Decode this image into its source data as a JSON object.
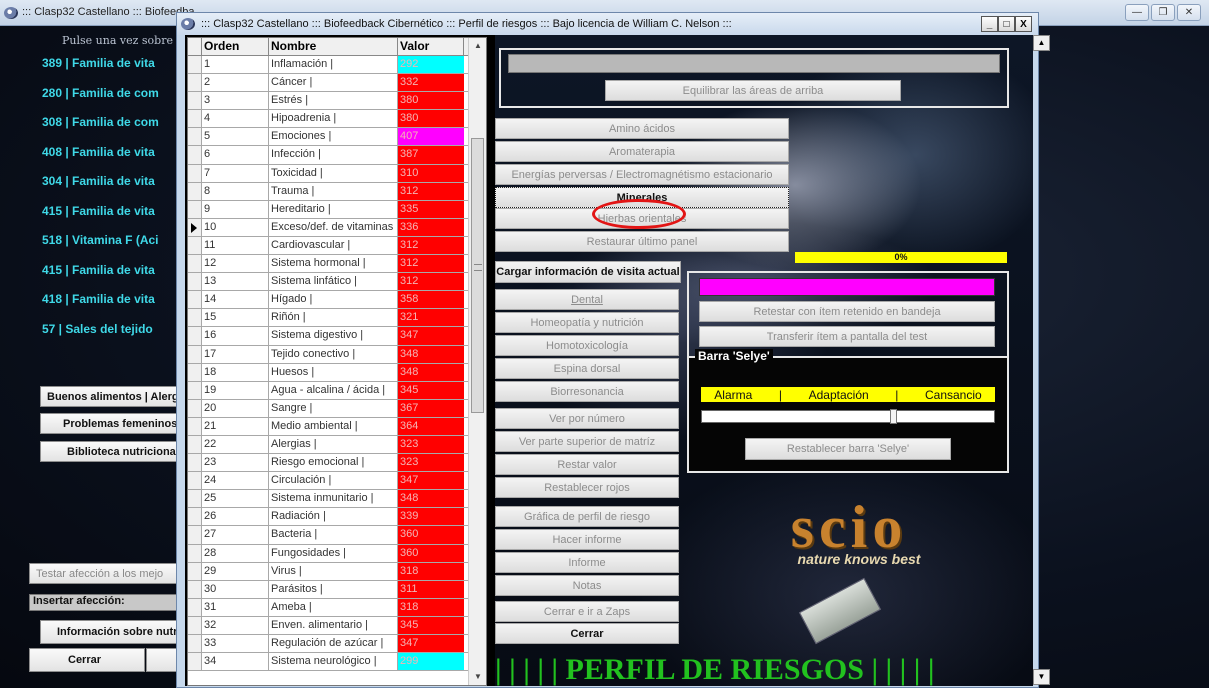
{
  "background_window": {
    "title": "::: Clasp32 Castellano ::: Biofeedba",
    "prompt": "Pulse una vez sobre una",
    "families": [
      "389 | Familia de vita",
      "280 | Familia de com",
      "308 | Familia de com",
      "408 | Familia de vita",
      "304 | Familia de vita",
      "415 | Familia de vita",
      "518 | Vitamina F (Aci",
      "415 | Familia de vita",
      "418 | Familia de vita",
      "57 | Sales del tejido"
    ],
    "buttons": {
      "buenos": "Buenos alimentos | Alerg",
      "problemas": "Problemas femeninos",
      "biblioteca": "Biblioteca nutricional",
      "testar": "Testar afección a los mejo",
      "insert": "Insertar afección:",
      "info": "Información sobre nutri",
      "cerrar": "Cerrar"
    },
    "window_controls": [
      "—",
      "❐",
      "✕"
    ]
  },
  "main_window": {
    "title": "::: Clasp32 Castellano ::: Biofeedback Cibernético ::: Perfil de riesgos ::: Bajo licencia de William C. Nelson :::",
    "controls": [
      "_",
      "□",
      "X"
    ]
  },
  "grid": {
    "headers": [
      "Orden",
      "Nombre",
      "Valor"
    ],
    "current_row": 10,
    "rows": [
      {
        "orden": "1",
        "nombre": "Inflamación |",
        "valor": "292",
        "color": "#00ffff"
      },
      {
        "orden": "2",
        "nombre": "Cáncer |",
        "valor": "332",
        "color": "#ff0000"
      },
      {
        "orden": "3",
        "nombre": "Estrés |",
        "valor": "380",
        "color": "#ff0000"
      },
      {
        "orden": "4",
        "nombre": "Hipoadrenia |",
        "valor": "380",
        "color": "#ff0000"
      },
      {
        "orden": "5",
        "nombre": "Emociones |",
        "valor": "407",
        "color": "#ff00ff"
      },
      {
        "orden": "6",
        "nombre": "Infección |",
        "valor": "387",
        "color": "#ff0000"
      },
      {
        "orden": "7",
        "nombre": "Toxicidad |",
        "valor": "310",
        "color": "#ff0000"
      },
      {
        "orden": "8",
        "nombre": "Trauma |",
        "valor": "312",
        "color": "#ff0000"
      },
      {
        "orden": "9",
        "nombre": "Hereditario |",
        "valor": "335",
        "color": "#ff0000"
      },
      {
        "orden": "10",
        "nombre": "Exceso/def. de vitaminas |",
        "valor": "336",
        "color": "#ff0000"
      },
      {
        "orden": "11",
        "nombre": "Cardiovascular |",
        "valor": "312",
        "color": "#ff0000"
      },
      {
        "orden": "12",
        "nombre": "Sistema hormonal |",
        "valor": "312",
        "color": "#ff0000"
      },
      {
        "orden": "13",
        "nombre": "Sistema linfático |",
        "valor": "312",
        "color": "#ff0000"
      },
      {
        "orden": "14",
        "nombre": "Hígado |",
        "valor": "358",
        "color": "#ff0000"
      },
      {
        "orden": "15",
        "nombre": "Riñón |",
        "valor": "321",
        "color": "#ff0000"
      },
      {
        "orden": "16",
        "nombre": "Sistema digestivo |",
        "valor": "347",
        "color": "#ff0000"
      },
      {
        "orden": "17",
        "nombre": "Tejido conectivo |",
        "valor": "348",
        "color": "#ff0000"
      },
      {
        "orden": "18",
        "nombre": "Huesos |",
        "valor": "348",
        "color": "#ff0000"
      },
      {
        "orden": "19",
        "nombre": "Agua - alcalina / ácida |",
        "valor": "345",
        "color": "#ff0000"
      },
      {
        "orden": "20",
        "nombre": "Sangre |",
        "valor": "367",
        "color": "#ff0000"
      },
      {
        "orden": "21",
        "nombre": "Medio ambiental |",
        "valor": "364",
        "color": "#ff0000"
      },
      {
        "orden": "22",
        "nombre": "Alergias |",
        "valor": "323",
        "color": "#ff0000"
      },
      {
        "orden": "23",
        "nombre": "Riesgo emocional |",
        "valor": "323",
        "color": "#ff0000"
      },
      {
        "orden": "24",
        "nombre": "Circulación |",
        "valor": "347",
        "color": "#ff0000"
      },
      {
        "orden": "25",
        "nombre": "Sistema inmunitario |",
        "valor": "348",
        "color": "#ff0000"
      },
      {
        "orden": "26",
        "nombre": "Radiación |",
        "valor": "339",
        "color": "#ff0000"
      },
      {
        "orden": "27",
        "nombre": "Bacteria |",
        "valor": "360",
        "color": "#ff0000"
      },
      {
        "orden": "28",
        "nombre": "Fungosidades |",
        "valor": "360",
        "color": "#ff0000"
      },
      {
        "orden": "29",
        "nombre": "Virus |",
        "valor": "318",
        "color": "#ff0000"
      },
      {
        "orden": "30",
        "nombre": "Parásitos |",
        "valor": "311",
        "color": "#ff0000"
      },
      {
        "orden": "31",
        "nombre": "Ameba |",
        "valor": "318",
        "color": "#ff0000"
      },
      {
        "orden": "32",
        "nombre": "Enven. alimentario |",
        "valor": "345",
        "color": "#ff0000"
      },
      {
        "orden": "33",
        "nombre": "Regulación de azúcar |",
        "valor": "347",
        "color": "#ff0000"
      },
      {
        "orden": "34",
        "nombre": "Sistema neurológico |",
        "valor": "299",
        "color": "#00ffff"
      }
    ]
  },
  "panel": {
    "text_field_value": "",
    "equilibrar": "Equilibrar las áreas de arriba",
    "categories": [
      "Amino ácidos",
      "Aromaterapia",
      "Energías perversas / Electromagnétismo estacionario",
      "Minerales",
      "Hierbas orientales",
      "Restaurar último panel"
    ],
    "selected_category": "Minerales",
    "progress": {
      "value": 0,
      "label": "0%"
    },
    "cargar": "Cargar información de visita actual",
    "left_buttons": [
      "Dental",
      "Homeopatía y nutrición",
      "Homotoxicología",
      "Espina dorsal",
      "Biorresonancia",
      "Ver por número",
      "Ver parte superior de matríz",
      "Restar valor",
      "Restablecer rojos",
      "Gráfica de perfil de riesgo",
      "Hacer informe",
      "Informe",
      "Notas",
      "Cerrar e ir a Zaps",
      "Cerrar"
    ],
    "retestar": "Retestar con ítem retenido en bandeja",
    "transferir": "Transferir ítem a pantalla del test",
    "selye": {
      "title": "Barra 'Selye'",
      "labels": [
        "Alarma",
        "|",
        "Adaptación",
        "|",
        "Cansancio"
      ],
      "slider_value": 0.66,
      "reset": "Restablecer barra 'Selye'"
    },
    "logo": {
      "word": "scio",
      "tagline": "nature knows best"
    },
    "banner": "|  |  |  |  |    PERFIL DE RIESGOS    |  |  |  |  |"
  },
  "colors": {
    "red": "#ff0000",
    "cyan": "#00ffff",
    "magenta": "#ff00ff",
    "yellow": "#ffff00",
    "banner_green": "#22c11f",
    "family_cyan": "#3fd9e8",
    "highlight_ellipse": "#e21515"
  }
}
